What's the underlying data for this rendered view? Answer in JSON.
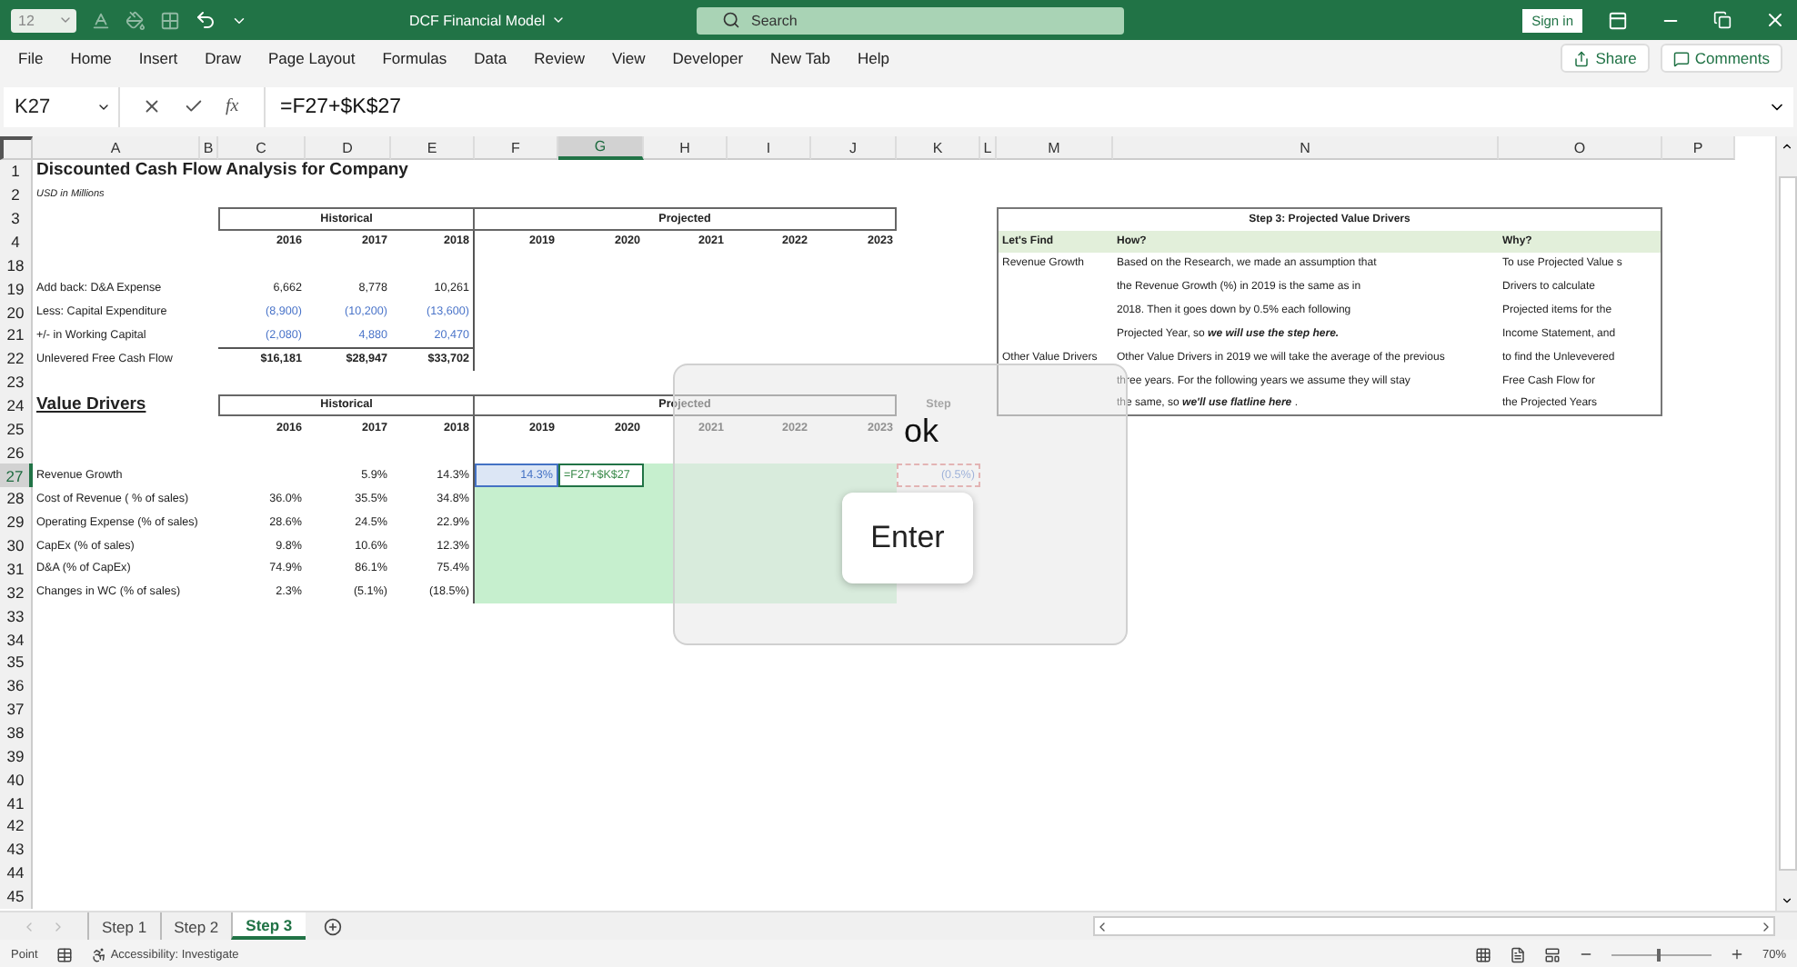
{
  "title_bar": {
    "font_size": "12",
    "title": "DCF Financial Model",
    "search": {
      "placeholder": "Search"
    },
    "sign_in": "Sign in"
  },
  "menu": {
    "items": [
      "File",
      "Home",
      "Insert",
      "Draw",
      "Page Layout",
      "Formulas",
      "Data",
      "Review",
      "View",
      "Developer",
      "New Tab",
      "Help"
    ],
    "share": "Share",
    "comments": "Comments"
  },
  "formula_bar": {
    "name_box": "K27",
    "function_label": "fx",
    "formula": "=F27+$K$27"
  },
  "columns": [
    {
      "label": "A",
      "selected": false
    },
    {
      "label": "B",
      "selected": false
    },
    {
      "label": "C",
      "selected": false
    },
    {
      "label": "D",
      "selected": false
    },
    {
      "label": "E",
      "selected": false
    },
    {
      "label": "F",
      "selected": false
    },
    {
      "label": "G",
      "selected": true
    },
    {
      "label": "H",
      "selected": false
    },
    {
      "label": "I",
      "selected": false
    },
    {
      "label": "J",
      "selected": false
    },
    {
      "label": "K",
      "selected": false
    },
    {
      "label": "L",
      "selected": false
    },
    {
      "label": "M",
      "selected": false
    },
    {
      "label": "N",
      "selected": false
    },
    {
      "label": "O",
      "selected": false
    },
    {
      "label": "P",
      "selected": false
    }
  ],
  "rows": [
    {
      "number": "1",
      "selected": false,
      "shaded": false,
      "kind": "title",
      "cells": [
        "Discounted Cash Flow Analysis for Company"
      ]
    },
    {
      "number": "2",
      "selected": false,
      "shaded": false,
      "kind": "note",
      "cells": [
        "USD in Millions"
      ]
    },
    {
      "number": "3",
      "selected": false,
      "shaded": false,
      "kind": "band",
      "cells": [
        null,
        null,
        null,
        "Historical",
        null,
        null,
        null,
        "Projected"
      ]
    },
    {
      "number": "4",
      "selected": false,
      "shaded": false,
      "kind": "years",
      "cells": [
        null,
        null,
        "2016",
        "2017",
        "2018",
        "2019",
        "2020",
        "2021",
        "2022",
        "2023"
      ]
    },
    {
      "number": "18",
      "selected": false,
      "shaded": false,
      "kind": "spacer"
    },
    {
      "number": "19",
      "selected": false,
      "shaded": false,
      "kind": "data",
      "cells": [
        "Add back: D&A Expense",
        null,
        "6,662",
        "8,778",
        "10,261"
      ]
    },
    {
      "number": "20",
      "selected": false,
      "shaded": false,
      "kind": "input",
      "cells": [
        "Less: Capital Expenditure",
        null,
        "(8,900)",
        "(10,200)",
        "(13,600)"
      ]
    },
    {
      "number": "21",
      "selected": false,
      "shaded": false,
      "kind": "input",
      "cells": [
        "+/- in Working Capital",
        null,
        "(2,080)",
        "4,880",
        "20,470"
      ]
    },
    {
      "number": "22",
      "selected": false,
      "shaded": false,
      "kind": "total",
      "cells": [
        "Unlevered Free Cash Flow",
        null,
        "$16,181",
        "$28,947",
        "$33,702"
      ]
    },
    {
      "number": "23",
      "selected": false,
      "shaded": false,
      "kind": "blank"
    },
    {
      "number": "24",
      "selected": false,
      "shaded": false,
      "kind": "section",
      "cells": [
        "Value Drivers",
        null,
        null,
        "Historical",
        null,
        null,
        null,
        "Projected",
        null,
        null,
        "Step"
      ]
    },
    {
      "number": "25",
      "selected": false,
      "shaded": false,
      "kind": "years",
      "cells": [
        null,
        null,
        "2016",
        "2017",
        "2018",
        "2019",
        "2020",
        "2021",
        "2022",
        "2023"
      ]
    },
    {
      "number": "26",
      "selected": false,
      "shaded": false,
      "kind": "spacer"
    },
    {
      "number": "27",
      "selected": true,
      "shaded": true,
      "kind": "driver",
      "cells": [
        "Revenue Growth",
        null,
        null,
        "5.9%",
        "14.3%",
        {
          "text": "14.3%",
          "kind": "referenced"
        },
        {
          "text": "=F27+$K$27",
          "kind": "editing"
        },
        null,
        null,
        null,
        {
          "text": "(0.5%)",
          "kind": "marked"
        }
      ]
    },
    {
      "number": "28",
      "selected": false,
      "shaded": true,
      "kind": "driver",
      "cells": [
        "Cost of Revenue ( % of sales)",
        null,
        "36.0%",
        "35.5%",
        "34.8%"
      ]
    },
    {
      "number": "29",
      "selected": false,
      "shaded": true,
      "kind": "driver",
      "cells": [
        "Operating Expense (% of sales)",
        null,
        "28.6%",
        "24.5%",
        "22.9%"
      ]
    },
    {
      "number": "30",
      "selected": false,
      "shaded": true,
      "kind": "driver",
      "cells": [
        "CapEx (% of sales)",
        null,
        "9.8%",
        "10.6%",
        "12.3%"
      ]
    },
    {
      "number": "31",
      "selected": false,
      "shaded": true,
      "kind": "driver",
      "cells": [
        "D&A (% of CapEx)",
        null,
        "74.9%",
        "86.1%",
        "75.4%"
      ]
    },
    {
      "number": "32",
      "selected": false,
      "shaded": true,
      "kind": "driver",
      "cells": [
        "Changes in WC (% of sales)",
        null,
        "2.3%",
        "(5.1%)",
        "(18.5%)"
      ]
    },
    {
      "number": "33",
      "selected": false,
      "shaded": false,
      "kind": "blank"
    },
    {
      "number": "34",
      "selected": false,
      "shaded": false,
      "kind": "blank"
    },
    {
      "number": "35",
      "selected": false,
      "shaded": false,
      "kind": "blank"
    },
    {
      "number": "36",
      "selected": false,
      "shaded": false,
      "kind": "blank"
    },
    {
      "number": "37",
      "selected": false,
      "shaded": false,
      "kind": "blank"
    },
    {
      "number": "38",
      "selected": false,
      "shaded": false,
      "kind": "blank"
    },
    {
      "number": "39",
      "selected": false,
      "shaded": false,
      "kind": "blank"
    },
    {
      "number": "40",
      "selected": false,
      "shaded": false,
      "kind": "blank"
    },
    {
      "number": "41",
      "selected": false,
      "shaded": false,
      "kind": "blank"
    },
    {
      "number": "42",
      "selected": false,
      "shaded": false,
      "kind": "blank"
    },
    {
      "number": "43",
      "selected": false,
      "shaded": false,
      "kind": "blank"
    },
    {
      "number": "44",
      "selected": false,
      "shaded": false,
      "kind": "blank"
    },
    {
      "number": "45",
      "selected": false,
      "shaded": false,
      "kind": "blank"
    }
  ],
  "drivers_panel": {
    "title": "Step 3: Projected Value Drivers",
    "headers": [
      "Let's Find",
      "How?",
      "Why?"
    ],
    "lines": [
      {
        "find": "Revenue Growth",
        "how": "Based on the Research, we made an assumption that",
        "why": "To use Projected Value s"
      },
      {
        "how": "the Revenue Growth (%) in 2019 is the same as in",
        "why": "Drivers to calculate"
      },
      {
        "how": "2018. Then it goes down by 0.5% each following",
        "why": "Projected items for the"
      },
      {
        "how": "Projected Year, so **we will use the step here.**",
        "why": "Income Statement, and"
      },
      {
        "find": "Other Value Drivers",
        "how": "Other Value Drivers in 2019 we will take the average of the previous",
        "why": "to find the Unlevevered"
      },
      {
        "how": "three years. For the following years we assume they will stay",
        "why": "Free Cash Flow for"
      },
      {
        "how": "the same, so **we'll use flatline here** .",
        "why": "the Projected Years"
      }
    ]
  },
  "overlay": {
    "caption": "ok",
    "key": "Enter"
  },
  "tabs": [
    {
      "label": "Step 1",
      "selected": false
    },
    {
      "label": "Step 2",
      "selected": false
    },
    {
      "label": "Step 3",
      "selected": true
    }
  ],
  "status_bar": {
    "mode": "Point",
    "accessibility": "Accessibility: Investigate",
    "zoom": {
      "reading": "70%",
      "level": 0.45
    }
  }
}
